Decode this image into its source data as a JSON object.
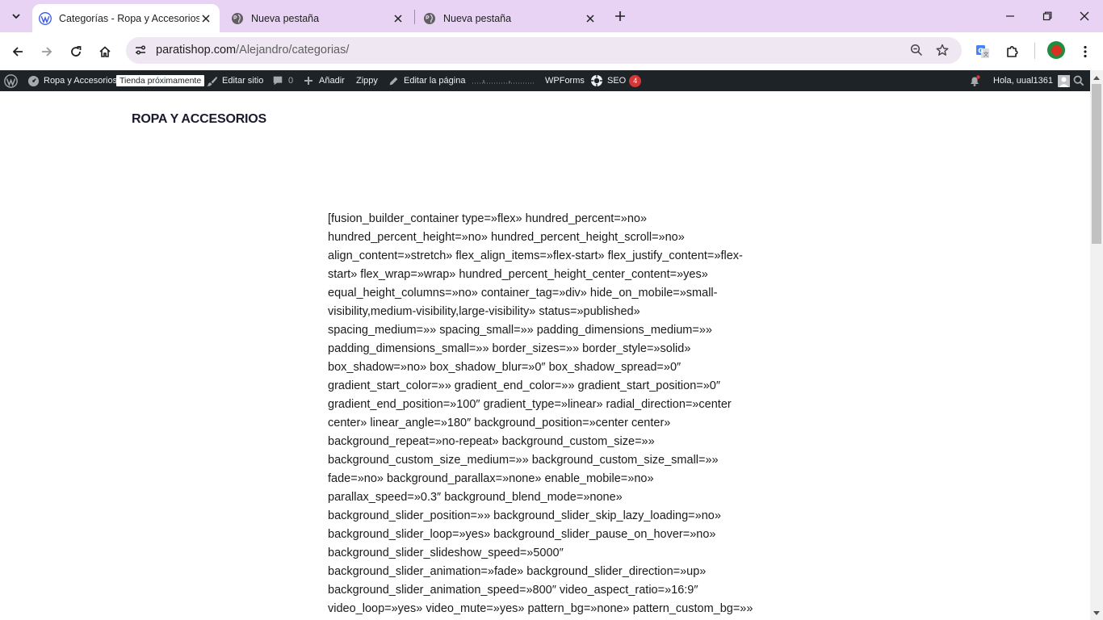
{
  "browser": {
    "tabs": [
      {
        "title": "Categorías - Ropa y Accesorios",
        "favicon": "wordpress-icon",
        "active": true
      },
      {
        "title": "Nueva pestaña",
        "favicon": "globe-icon",
        "active": false
      },
      {
        "title": "Nueva pestaña",
        "favicon": "globe-icon",
        "active": false
      }
    ],
    "url_host": "paratishop.com",
    "url_path": "/Alejandro/categorias/"
  },
  "adminbar": {
    "site_name": "Ropa y Accesorios",
    "coming_soon": "Tienda próximamente",
    "edit_site": "Editar sitio",
    "comments_count": "0",
    "add_new": "Añadir",
    "zippy": "Zippy",
    "edit_page": "Editar la página",
    "wpforms": "WPForms",
    "seo": "SEO",
    "seo_count": "4",
    "greeting": "Hola, uual1361"
  },
  "page": {
    "site_title": "ROPA Y ACCESORIOS",
    "shortcode_lines": [
      "[fusion_builder_container type=»flex» hundred_percent=»no»",
      "hundred_percent_height=»no» hundred_percent_height_scroll=»no»",
      "align_content=»stretch» flex_align_items=»flex-start» flex_justify_content=»flex-",
      "start» flex_wrap=»wrap» hundred_percent_height_center_content=»yes»",
      "equal_height_columns=»no» container_tag=»div» hide_on_mobile=»small-",
      "visibility,medium-visibility,large-visibility» status=»published»",
      "spacing_medium=»» spacing_small=»» padding_dimensions_medium=»»",
      "padding_dimensions_small=»» border_sizes=»» border_style=»solid»",
      "box_shadow=»no» box_shadow_blur=»0″ box_shadow_spread=»0″",
      "gradient_start_color=»» gradient_end_color=»» gradient_start_position=»0″",
      "gradient_end_position=»100″ gradient_type=»linear» radial_direction=»center",
      "center» linear_angle=»180″ background_position=»center center»",
      "background_repeat=»no-repeat» background_custom_size=»»",
      "background_custom_size_medium=»» background_custom_size_small=»»",
      "fade=»no» background_parallax=»none» enable_mobile=»no»",
      "parallax_speed=»0.3″ background_blend_mode=»none»",
      "background_slider_position=»» background_slider_skip_lazy_loading=»no»",
      "background_slider_loop=»yes» background_slider_pause_on_hover=»no»",
      "background_slider_slideshow_speed=»5000″",
      "background_slider_animation=»fade» background_slider_direction=»up»",
      "background_slider_animation_speed=»800″ video_aspect_ratio=»16:9″",
      "video_loop=»yes» video_mute=»yes» pattern_bg=»none» pattern_custom_bg=»»"
    ]
  }
}
